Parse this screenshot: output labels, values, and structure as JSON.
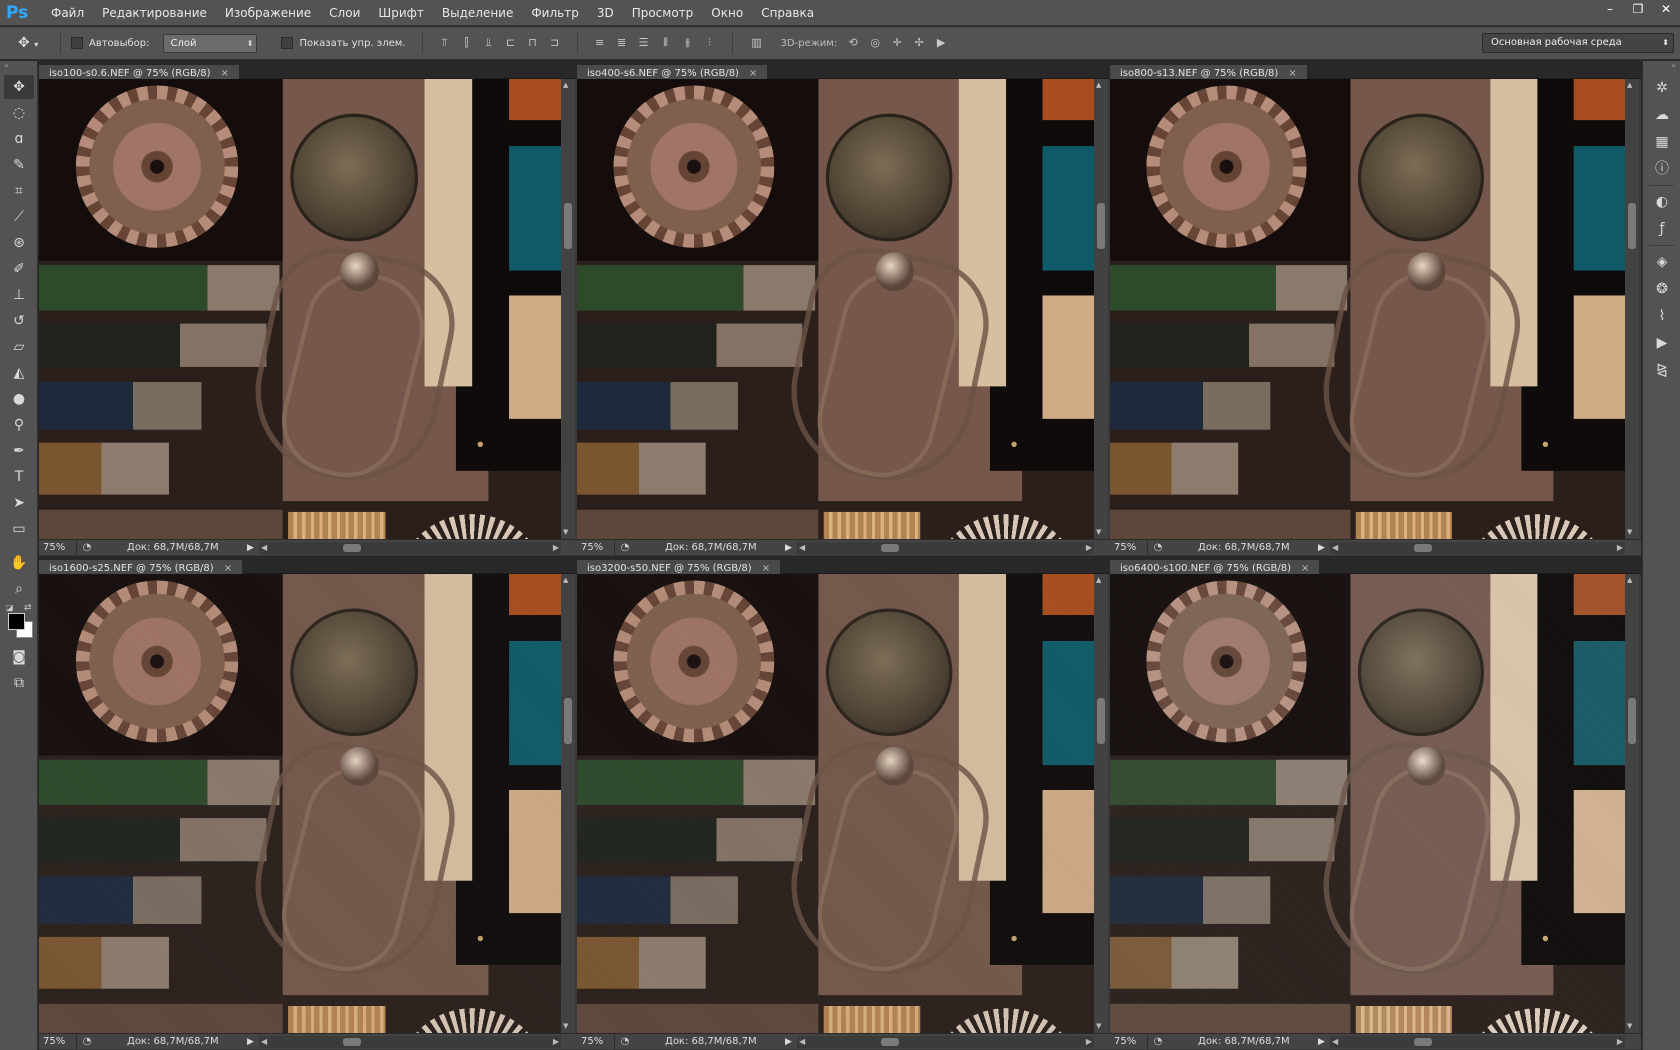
{
  "app": {
    "logo": "Ps"
  },
  "menu": [
    "Файл",
    "Редактирование",
    "Изображение",
    "Слои",
    "Шрифт",
    "Выделение",
    "Фильтр",
    "3D",
    "Просмотр",
    "Окно",
    "Справка"
  ],
  "window_controls": {
    "minimize": "–",
    "restore": "❐",
    "close": "✕"
  },
  "options": {
    "autoselect_label": "Автовыбор:",
    "autoselect_value": "Слой",
    "show_controls_label": "Показать упр. элем.",
    "mode_3d_label": "3D-режим:",
    "workspace_value": "Основная рабочая среда"
  },
  "documents": [
    {
      "title": "iso100-s0.6.NEF @ 75% (RGB/8)",
      "zoom": "75%",
      "doc_info": "Док: 68,7M/68,7M"
    },
    {
      "title": "iso400-s6.NEF @ 75% (RGB/8)",
      "zoom": "75%",
      "doc_info": "Док: 68,7M/68,7M"
    },
    {
      "title": "iso800-s13.NEF @ 75% (RGB/8)",
      "zoom": "75%",
      "doc_info": "Док: 68,7M/68,7M"
    },
    {
      "title": "iso1600-s25.NEF @ 75% (RGB/8)",
      "zoom": "75%",
      "doc_info": "Док: 68,7M/68,7M"
    },
    {
      "title": "iso3200-s50.NEF @ 75% (RGB/8)",
      "zoom": "75%",
      "doc_info": "Док: 68,7M/68,7M"
    },
    {
      "title": "iso6400-s100.NEF @ 75% (RGB/8)",
      "zoom": "75%",
      "doc_info": "Док: 68,7M/68,7M"
    }
  ],
  "icons": {
    "tools": [
      "move-tool-icon",
      "marquee-tool-icon",
      "lasso-tool-icon",
      "quick-selection-tool-icon",
      "crop-tool-icon",
      "eyedropper-tool-icon",
      "spot-healing-tool-icon",
      "brush-tool-icon",
      "clone-stamp-tool-icon",
      "history-brush-tool-icon",
      "eraser-tool-icon",
      "paint-bucket-tool-icon",
      "blur-tool-icon",
      "dodge-tool-icon",
      "pen-tool-icon",
      "type-tool-icon",
      "path-selection-tool-icon",
      "rectangle-tool-icon",
      "hand-tool-icon",
      "zoom-tool-icon"
    ],
    "panels": [
      "history-panel-icon",
      "swatches-panel-icon",
      "navigator-panel-icon",
      "info-panel-icon",
      "adjustments-panel-icon",
      "styles-panel-icon",
      "layers-panel-icon",
      "channels-panel-icon",
      "paths-panel-icon",
      "actions-panel-icon",
      "brush-presets-panel-icon"
    ]
  }
}
